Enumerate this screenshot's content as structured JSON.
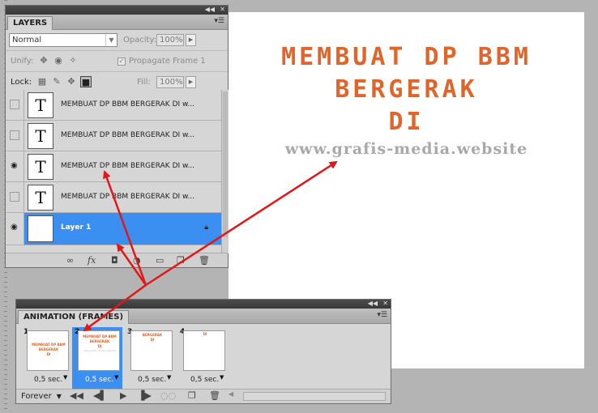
{
  "canvas": {
    "lines": [
      "MEMBUAT DP BBM",
      "BERGERAK",
      "DI"
    ],
    "url": "www.grafis-media.website"
  },
  "layers_panel": {
    "tab": "LAYERS",
    "blend_mode": "Normal",
    "opacity_label": "Opacity:",
    "opacity_value": "100%",
    "unify_label": "Unify:",
    "propagate_label": "Propagate Frame 1",
    "lock_label": "Lock:",
    "fill_label": "Fill:",
    "fill_value": "100%",
    "layers": [
      {
        "name": "MEMBUAT DP BBM BERGERAK  DI w...",
        "thumb": "T",
        "visible": false
      },
      {
        "name": "MEMBUAT DP BBM BERGERAK  DI w...",
        "thumb": "T",
        "visible": false
      },
      {
        "name": "MEMBUAT DP BBM BERGERAK  DI w...",
        "thumb": "T",
        "visible": true
      },
      {
        "name": "MEMBUAT DP BBM BERGERAK  DI w...",
        "thumb": "T",
        "visible": false
      },
      {
        "name": "Layer 1",
        "thumb": "",
        "visible": true,
        "selected": true
      }
    ]
  },
  "animation_panel": {
    "tab": "ANIMATION (FRAMES)",
    "frames": [
      {
        "number": "1",
        "delay": "0,5 sec."
      },
      {
        "number": "2",
        "delay": "0,5 sec.",
        "selected": true
      },
      {
        "number": "3",
        "delay": "0,5 sec."
      },
      {
        "number": "4",
        "delay": "0,5 sec."
      }
    ],
    "loop": "Forever"
  },
  "colors": {
    "accent": "#3a8ff0",
    "title_text": "#e0652b",
    "url_text": "#a9a9a9",
    "arrow": "#e01818"
  }
}
